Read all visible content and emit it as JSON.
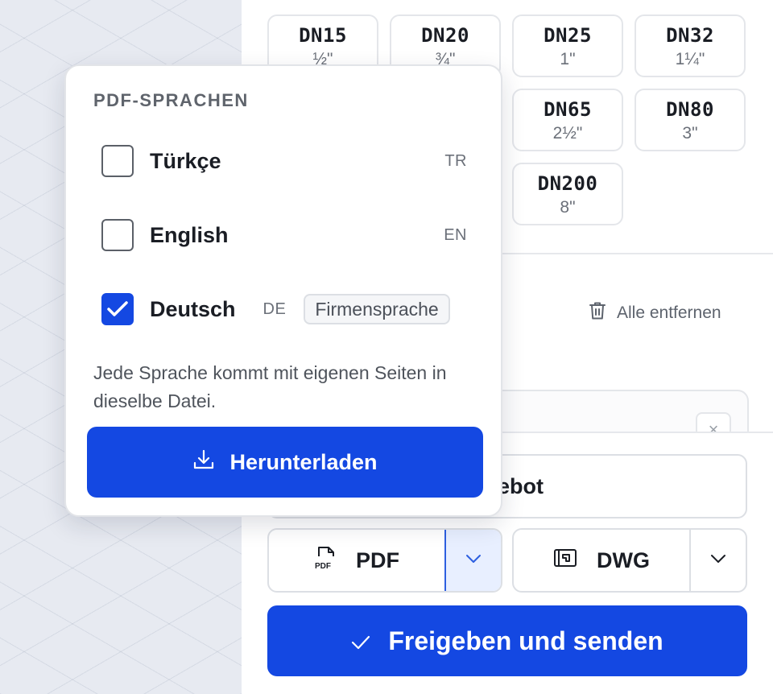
{
  "sizes": [
    {
      "dn": "DN15",
      "inch": "½\""
    },
    {
      "dn": "DN20",
      "inch": "¾\""
    },
    {
      "dn": "DN25",
      "inch": "1\""
    },
    {
      "dn": "DN32",
      "inch": "1¼\""
    },
    {
      "dn": "DN65",
      "inch": "2½\""
    },
    {
      "dn": "DN80",
      "inch": "3\""
    },
    {
      "dn": "DN200",
      "inch": "8\""
    }
  ],
  "list": {
    "remove_all_label": "Alle entfernen",
    "remove_all_icon": "trash-icon",
    "item_close_glyph": "×"
  },
  "footer": {
    "offer_label": "ngebot",
    "pdf_label": "PDF",
    "pdf_icon": "pdf-file-icon",
    "dwg_label": "DWG",
    "dwg_icon": "drawing-icon",
    "send_label": "Freigeben und senden",
    "send_icon": "check-icon"
  },
  "popover": {
    "title": "PDF-SPRACHEN",
    "languages": [
      {
        "name": "Türkçe",
        "code": "TR",
        "checked": false
      },
      {
        "name": "English",
        "code": "EN",
        "checked": false
      },
      {
        "name": "Deutsch",
        "code": "DE",
        "checked": true,
        "tag": "Firmensprache"
      }
    ],
    "note": "Jede Sprache kommt mit eigenen Seiten in dieselbe Datei.",
    "download_label": "Herunterladen",
    "download_icon": "download-icon"
  },
  "colors": {
    "accent": "#1448e2",
    "canvas": "#e7eaf1",
    "border": "#e4e6ea",
    "muted_text": "#6b7079"
  }
}
